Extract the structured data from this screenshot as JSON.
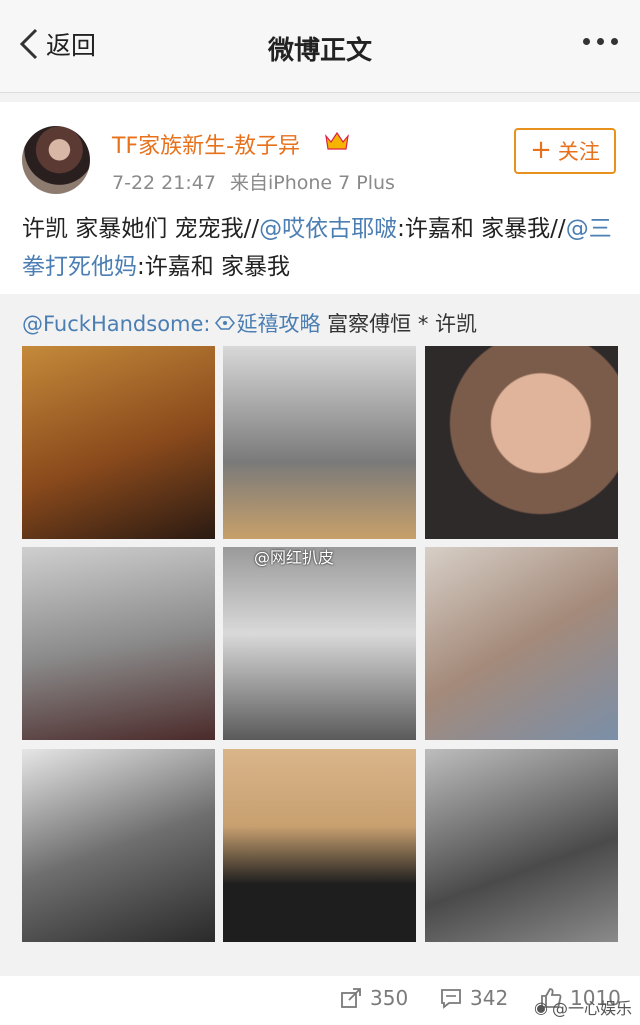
{
  "nav": {
    "back_label": "返回",
    "title": "微博正文"
  },
  "post": {
    "username": "TF家族新生-敖子异",
    "time": "7-22 21:47",
    "source": "来自iPhone 7 Plus",
    "follow_label": "关注",
    "text_part1": "许凯 家暴她们 宠宠我//",
    "mention1": "@哎依古耶啵",
    "text_part2": ":许嘉和 家暴我//",
    "mention2": "@三拳打死他妈",
    "text_part3": ":许嘉和 家暴我"
  },
  "repost": {
    "mention": "@FuckHandsome:",
    "tag": "延禧攻略",
    "rest": " 富察傅恒 * 许凯",
    "images": [
      "photo-1",
      "photo-2",
      "photo-3",
      "photo-4",
      "photo-5",
      "photo-6",
      "photo-7",
      "photo-8",
      "photo-9"
    ],
    "watermark": "@网红扒皮"
  },
  "actions": {
    "reposts": "350",
    "comments": "342",
    "likes": "1010"
  },
  "corner_watermark": "@一心娱乐",
  "colors": {
    "username": "#e8711c",
    "mention": "#4b7eb3",
    "follow_border": "#e8911c"
  }
}
